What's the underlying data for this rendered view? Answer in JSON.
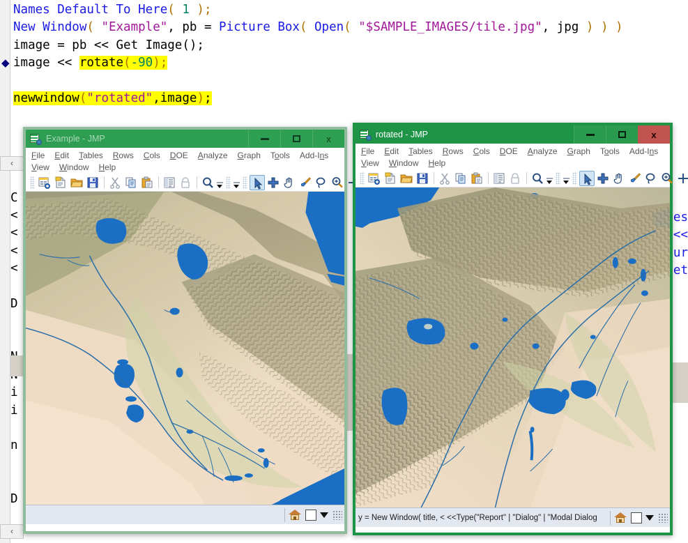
{
  "editor": {
    "lines": [
      {
        "marker": false,
        "tokens": [
          {
            "t": "Names Default To Here",
            "c": "kw"
          },
          {
            "t": "( ",
            "c": "paren"
          },
          {
            "t": "1",
            "c": "num"
          },
          {
            "t": " );",
            "c": "paren"
          }
        ]
      },
      {
        "marker": false,
        "tokens": [
          {
            "t": "New Window",
            "c": "kw"
          },
          {
            "t": "( ",
            "c": "paren"
          },
          {
            "t": "\"Example\"",
            "c": "str"
          },
          {
            "t": ", pb = ",
            "c": "pun"
          },
          {
            "t": "Picture Box",
            "c": "kw"
          },
          {
            "t": "( ",
            "c": "paren"
          },
          {
            "t": "Open",
            "c": "fn"
          },
          {
            "t": "( ",
            "c": "paren"
          },
          {
            "t": "\"$SAMPLE_IMAGES/tile.jpg\"",
            "c": "str"
          },
          {
            "t": ", jpg ",
            "c": "pun"
          },
          {
            "t": ") ) )",
            "c": "paren"
          }
        ]
      },
      {
        "marker": false,
        "tokens": [
          {
            "t": "image = pb << Get Image();",
            "c": "pun"
          }
        ]
      },
      {
        "marker": true,
        "tokens": [
          {
            "t": "image << ",
            "c": "pun"
          },
          {
            "t": "rotate",
            "c": "pun",
            "hl": true
          },
          {
            "t": "(",
            "c": "paren",
            "hl": true
          },
          {
            "t": "-90",
            "c": "num",
            "hl": true
          },
          {
            "t": ");",
            "c": "paren",
            "hl": true
          }
        ]
      },
      {
        "marker": false,
        "tokens": []
      },
      {
        "marker": false,
        "tokens": [
          {
            "t": "newwindow",
            "c": "pun",
            "hl": true
          },
          {
            "t": "(",
            "c": "paren",
            "hl": true
          },
          {
            "t": "\"rotated\"",
            "c": "str",
            "hl": true
          },
          {
            "t": ",",
            "c": "pun",
            "hl": true
          },
          {
            "t": "image",
            "c": "pun",
            "hl": true
          },
          {
            "t": ")",
            "c": "paren",
            "hl": true
          },
          {
            "t": ";",
            "c": "pun",
            "hl": true
          }
        ]
      }
    ],
    "background_left_glyphs": "\n\n\n\nC\n<\n<\n<\n<\n\nD\n\n\nN\nN\ni\ni\n\nn\n\n\nD",
    "background_right_glyphs": "es\n<<\nur\net",
    "scroll_left_label": "‹",
    "scroll_bottom_label": "‹"
  },
  "menu": {
    "row1": [
      {
        "pre": "",
        "acc": "F",
        "post": "ile"
      },
      {
        "pre": "",
        "acc": "E",
        "post": "dit"
      },
      {
        "pre": "",
        "acc": "T",
        "post": "ables"
      },
      {
        "pre": "",
        "acc": "R",
        "post": "ows"
      },
      {
        "pre": "",
        "acc": "C",
        "post": "ols"
      },
      {
        "pre": "",
        "acc": "D",
        "post": "OE"
      },
      {
        "pre": "",
        "acc": "A",
        "post": "nalyze"
      },
      {
        "pre": "",
        "acc": "G",
        "post": "raph"
      },
      {
        "pre": "T",
        "acc": "o",
        "post": "ols"
      },
      {
        "pre": "Add-I",
        "acc": "n",
        "post": "s"
      }
    ],
    "row2": [
      {
        "pre": "",
        "acc": "V",
        "post": "iew"
      },
      {
        "pre": "",
        "acc": "W",
        "post": "indow"
      },
      {
        "pre": "",
        "acc": "H",
        "post": "elp"
      }
    ]
  },
  "toolbar": {
    "group1": [
      "new-data-table-icon",
      "new-script-icon",
      "open-icon",
      "save-icon",
      "cut-icon",
      "copy-icon",
      "paste-icon",
      "column-info-icon",
      "lock-icon",
      "search-icon"
    ],
    "group2": [
      "arrow-select-icon",
      "crosshair-icon",
      "hand-pan-icon",
      "brush-icon",
      "lasso-icon",
      "magnifier-zoom-icon",
      "annotate-icon"
    ],
    "selected_tool": "arrow-select-icon"
  },
  "windows": [
    {
      "id": "example",
      "title": "Example - JMP",
      "active": false,
      "status_text": "",
      "buttons": {
        "minimize": "–",
        "maximize": "□",
        "close": "x"
      },
      "image": "tile.jpg",
      "rotation": 0
    },
    {
      "id": "rotated",
      "title": "rotated - JMP",
      "active": true,
      "status_text": "y = New Window( title, < <<Type(\"Report\" | \"Dialog\" | \"Modal Dialog",
      "buttons": {
        "minimize": "–",
        "maximize": "□",
        "close": "x"
      },
      "image": "tile.jpg",
      "rotation": -90
    }
  ],
  "colors": {
    "title_active": "#1e9447",
    "title_inactive": "#2e9e52",
    "close_active": "#c1544e",
    "highlight": "#ffff00",
    "keyword": "#1a1ae6",
    "string": "#a0179a",
    "number": "#008060",
    "paren": "#b07000",
    "status_bg": "#e2e7f0",
    "water": "#1a6fc4",
    "land": "#d8c9ae"
  }
}
